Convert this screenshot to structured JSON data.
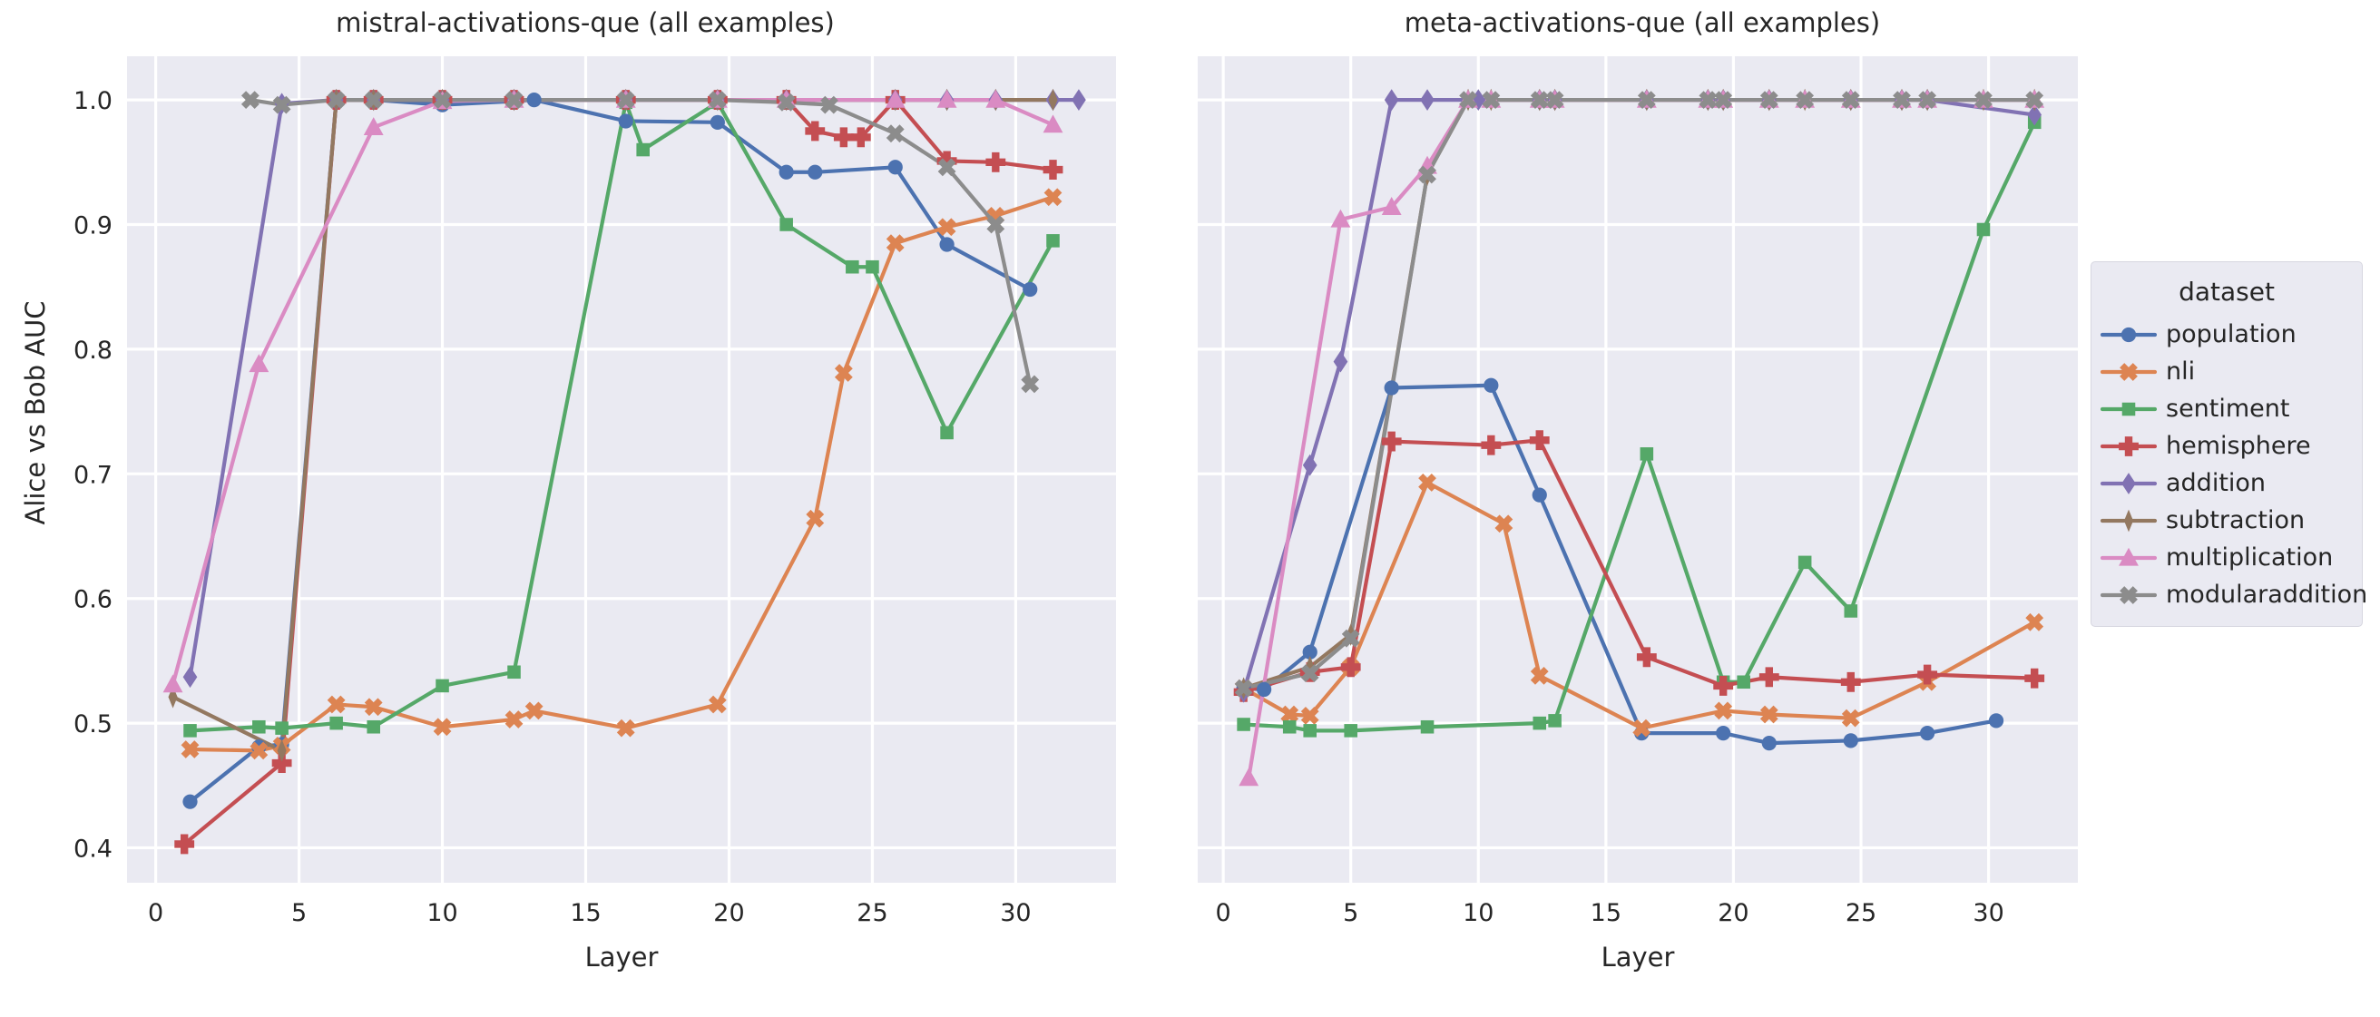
{
  "figure": {
    "background": "#ffffff",
    "axes_facecolor": "#eaeaf2",
    "grid_color": "#ffffff",
    "text_color": "#262626"
  },
  "legend": {
    "title": "dataset",
    "position": "right",
    "entries": [
      {
        "label": "population",
        "color": "#4c72b0",
        "marker": "circle"
      },
      {
        "label": "nli",
        "color": "#dd8452",
        "marker": "x-thick"
      },
      {
        "label": "sentiment",
        "color": "#55a868",
        "marker": "square"
      },
      {
        "label": "hemisphere",
        "color": "#c44e52",
        "marker": "plus-thick"
      },
      {
        "label": "addition",
        "color": "#8172b3",
        "marker": "diamond"
      },
      {
        "label": "subtraction",
        "color": "#937860",
        "marker": "thin-diamond"
      },
      {
        "label": "multiplication",
        "color": "#da8bc3",
        "marker": "triangle-up"
      },
      {
        "label": "modularaddition",
        "color": "#8c8c8c",
        "marker": "x-thick"
      }
    ]
  },
  "chart_data": [
    {
      "type": "line",
      "panel": "left",
      "title": "mistral-activations-que (all examples)",
      "xlabel": "Layer",
      "ylabel": "Alice vs Bob AUC",
      "xlim": [
        -1.0,
        33.5
      ],
      "ylim": [
        0.372,
        1.035
      ],
      "xticks": [
        0,
        5,
        10,
        15,
        20,
        25,
        30
      ],
      "yticks": [
        0.4,
        0.5,
        0.6,
        0.7,
        0.8,
        0.9,
        1.0
      ],
      "grid": true,
      "series": [
        {
          "name": "population",
          "color": "#4c72b0",
          "marker": "circle",
          "x": [
            1.2,
            3.6,
            4.4,
            6.3,
            7.6,
            10.0,
            12.5,
            13.2,
            16.4,
            19.6,
            22.0,
            23.0,
            25.8,
            27.6,
            30.5
          ],
          "y": [
            0.437,
            0.481,
            0.483,
            1.0,
            1.0,
            0.996,
            0.999,
            1.0,
            0.983,
            0.982,
            0.942,
            0.942,
            0.946,
            0.884,
            0.848
          ]
        },
        {
          "name": "nli",
          "color": "#dd8452",
          "marker": "x-thick",
          "x": [
            1.2,
            3.6,
            4.4,
            6.3,
            7.6,
            10.0,
            12.5,
            13.2,
            16.4,
            19.6,
            23.0,
            24.0,
            25.8,
            27.6,
            29.3,
            31.3
          ],
          "y": [
            0.479,
            0.478,
            0.482,
            0.515,
            0.513,
            0.497,
            0.503,
            0.51,
            0.496,
            0.515,
            0.664,
            0.781,
            0.885,
            0.898,
            0.907,
            0.922
          ]
        },
        {
          "name": "sentiment",
          "color": "#55a868",
          "marker": "square",
          "x": [
            1.2,
            3.6,
            4.4,
            6.3,
            7.6,
            10.0,
            12.5,
            16.4,
            17.0,
            19.6,
            22.0,
            24.3,
            25.0,
            27.6,
            31.3
          ],
          "y": [
            0.494,
            0.497,
            0.496,
            0.5,
            0.497,
            0.53,
            0.541,
            0.998,
            0.96,
            0.998,
            0.9,
            0.866,
            0.866,
            0.733,
            0.887
          ]
        },
        {
          "name": "hemisphere",
          "color": "#c44e52",
          "marker": "plus-thick",
          "x": [
            1.0,
            4.4,
            6.3,
            7.6,
            10.0,
            12.5,
            16.4,
            19.6,
            22.0,
            23.0,
            24.0,
            24.6,
            25.8,
            27.6,
            29.3,
            31.3
          ],
          "y": [
            0.403,
            0.468,
            1.0,
            1.0,
            1.0,
            1.0,
            1.0,
            1.0,
            1.0,
            0.975,
            0.97,
            0.97,
            1.0,
            0.951,
            0.95,
            0.944
          ]
        },
        {
          "name": "addition",
          "color": "#8172b3",
          "marker": "diamond",
          "x": [
            1.2,
            4.4,
            6.3,
            7.6,
            10.0,
            12.5,
            16.4,
            19.6,
            22.0,
            25.8,
            27.6,
            29.3,
            31.3,
            32.2
          ],
          "y": [
            0.537,
            0.997,
            1.0,
            1.0,
            1.0,
            1.0,
            1.0,
            1.0,
            1.0,
            1.0,
            1.0,
            1.0,
            1.0,
            1.0
          ]
        },
        {
          "name": "subtraction",
          "color": "#937860",
          "marker": "thin-diamond",
          "x": [
            0.6,
            4.4,
            6.3,
            7.6,
            10.0,
            12.5,
            16.4,
            19.6,
            22.0,
            25.8,
            27.6,
            29.3,
            31.3
          ],
          "y": [
            0.521,
            0.478,
            1.0,
            1.0,
            1.0,
            1.0,
            1.0,
            1.0,
            1.0,
            1.0,
            1.0,
            1.0,
            1.0
          ]
        },
        {
          "name": "multiplication",
          "color": "#da8bc3",
          "marker": "triangle-up",
          "x": [
            0.6,
            3.6,
            7.6,
            10.0,
            12.5,
            16.4,
            19.6,
            22.0,
            25.8,
            27.6,
            29.3,
            31.3
          ],
          "y": [
            0.531,
            0.788,
            0.978,
            0.999,
            1.0,
            1.0,
            1.0,
            1.0,
            1.0,
            1.0,
            1.0,
            0.98
          ]
        },
        {
          "name": "modularaddition",
          "color": "#8c8c8c",
          "marker": "x-thick",
          "x": [
            3.3,
            4.4,
            6.3,
            7.6,
            10.0,
            12.5,
            16.4,
            19.6,
            22.0,
            23.5,
            25.8,
            27.6,
            29.3,
            30.5
          ],
          "y": [
            1.0,
            0.996,
            1.0,
            1.0,
            1.0,
            1.0,
            1.0,
            1.0,
            0.998,
            0.996,
            0.973,
            0.946,
            0.9,
            0.772
          ]
        }
      ]
    },
    {
      "type": "line",
      "panel": "right",
      "title": "meta-activations-que (all examples)",
      "xlabel": "Layer",
      "ylabel": "Alice vs Bob AUC",
      "xlim": [
        -1.0,
        33.5
      ],
      "ylim": [
        0.372,
        1.035
      ],
      "xticks": [
        0,
        5,
        10,
        15,
        20,
        25,
        30
      ],
      "yticks": [
        0.4,
        0.5,
        0.6,
        0.7,
        0.8,
        0.9,
        1.0
      ],
      "grid": true,
      "series": [
        {
          "name": "population",
          "color": "#4c72b0",
          "marker": "circle",
          "x": [
            0.8,
            1.6,
            3.4,
            6.6,
            10.5,
            12.4,
            16.4,
            19.6,
            21.4,
            24.6,
            27.6,
            30.3
          ],
          "y": [
            0.528,
            0.527,
            0.557,
            0.769,
            0.771,
            0.683,
            0.492,
            0.492,
            0.484,
            0.486,
            0.492,
            0.502
          ]
        },
        {
          "name": "nli",
          "color": "#dd8452",
          "marker": "x-thick",
          "x": [
            0.8,
            2.6,
            3.4,
            5.0,
            8.0,
            11.0,
            12.4,
            16.4,
            19.6,
            21.4,
            24.6,
            27.6,
            31.8
          ],
          "y": [
            0.528,
            0.507,
            0.506,
            0.545,
            0.693,
            0.66,
            0.538,
            0.496,
            0.51,
            0.507,
            0.504,
            0.533,
            0.581
          ]
        },
        {
          "name": "sentiment",
          "color": "#55a868",
          "marker": "square",
          "x": [
            0.8,
            2.6,
            3.4,
            5.0,
            8.0,
            12.4,
            13.0,
            16.6,
            19.6,
            20.4,
            22.8,
            24.6,
            29.8,
            31.8
          ],
          "y": [
            0.499,
            0.497,
            0.494,
            0.494,
            0.497,
            0.5,
            0.502,
            0.716,
            0.533,
            0.533,
            0.629,
            0.59,
            0.896,
            0.982
          ]
        },
        {
          "name": "hemisphere",
          "color": "#c44e52",
          "marker": "plus-thick",
          "x": [
            0.8,
            3.4,
            5.0,
            6.6,
            10.5,
            12.4,
            16.6,
            19.6,
            21.4,
            24.6,
            27.6,
            31.8
          ],
          "y": [
            0.525,
            0.541,
            0.545,
            0.726,
            0.723,
            0.727,
            0.553,
            0.53,
            0.537,
            0.533,
            0.539,
            0.536
          ]
        },
        {
          "name": "addition",
          "color": "#8172b3",
          "marker": "diamond",
          "x": [
            0.8,
            3.4,
            4.6,
            6.6,
            8.0,
            10.0,
            12.4,
            13.0,
            16.6,
            19.0,
            19.6,
            21.4,
            24.6,
            26.6,
            27.6,
            31.8
          ],
          "y": [
            0.525,
            0.707,
            0.79,
            1.0,
            1.0,
            1.0,
            1.0,
            1.0,
            1.0,
            1.0,
            1.0,
            1.0,
            1.0,
            1.0,
            1.0,
            0.988
          ]
        },
        {
          "name": "subtraction",
          "color": "#937860",
          "marker": "thin-diamond",
          "x": [
            0.8,
            3.4,
            5.0,
            8.0,
            9.6,
            10.5,
            12.4,
            13.0,
            16.6,
            19.0,
            19.6,
            21.4,
            22.8,
            24.6,
            26.6,
            27.6,
            29.8,
            31.8
          ],
          "y": [
            0.528,
            0.545,
            0.571,
            0.94,
            1.0,
            1.0,
            1.0,
            1.0,
            1.0,
            1.0,
            1.0,
            1.0,
            1.0,
            1.0,
            1.0,
            1.0,
            1.0,
            1.0
          ]
        },
        {
          "name": "multiplication",
          "color": "#da8bc3",
          "marker": "triangle-up",
          "x": [
            1.0,
            4.6,
            6.6,
            8.0,
            9.6,
            10.5,
            12.4,
            13.0,
            16.6,
            19.0,
            19.6,
            21.4,
            22.8,
            24.6,
            26.6,
            27.6,
            29.8,
            31.8
          ],
          "y": [
            0.456,
            0.904,
            0.914,
            0.947,
            1.0,
            1.0,
            1.0,
            1.0,
            1.0,
            1.0,
            1.0,
            1.0,
            1.0,
            1.0,
            1.0,
            1.0,
            1.0,
            1.0
          ]
        },
        {
          "name": "modularaddition",
          "color": "#8c8c8c",
          "marker": "x-thick",
          "x": [
            0.8,
            3.4,
            5.0,
            8.0,
            9.6,
            10.5,
            12.4,
            13.0,
            16.6,
            19.0,
            19.6,
            21.4,
            22.8,
            24.6,
            26.6,
            27.6,
            29.8,
            31.8
          ],
          "y": [
            0.528,
            0.54,
            0.568,
            0.94,
            1.0,
            1.0,
            1.0,
            1.0,
            1.0,
            1.0,
            1.0,
            1.0,
            1.0,
            1.0,
            1.0,
            1.0,
            1.0,
            1.0
          ]
        }
      ]
    }
  ]
}
